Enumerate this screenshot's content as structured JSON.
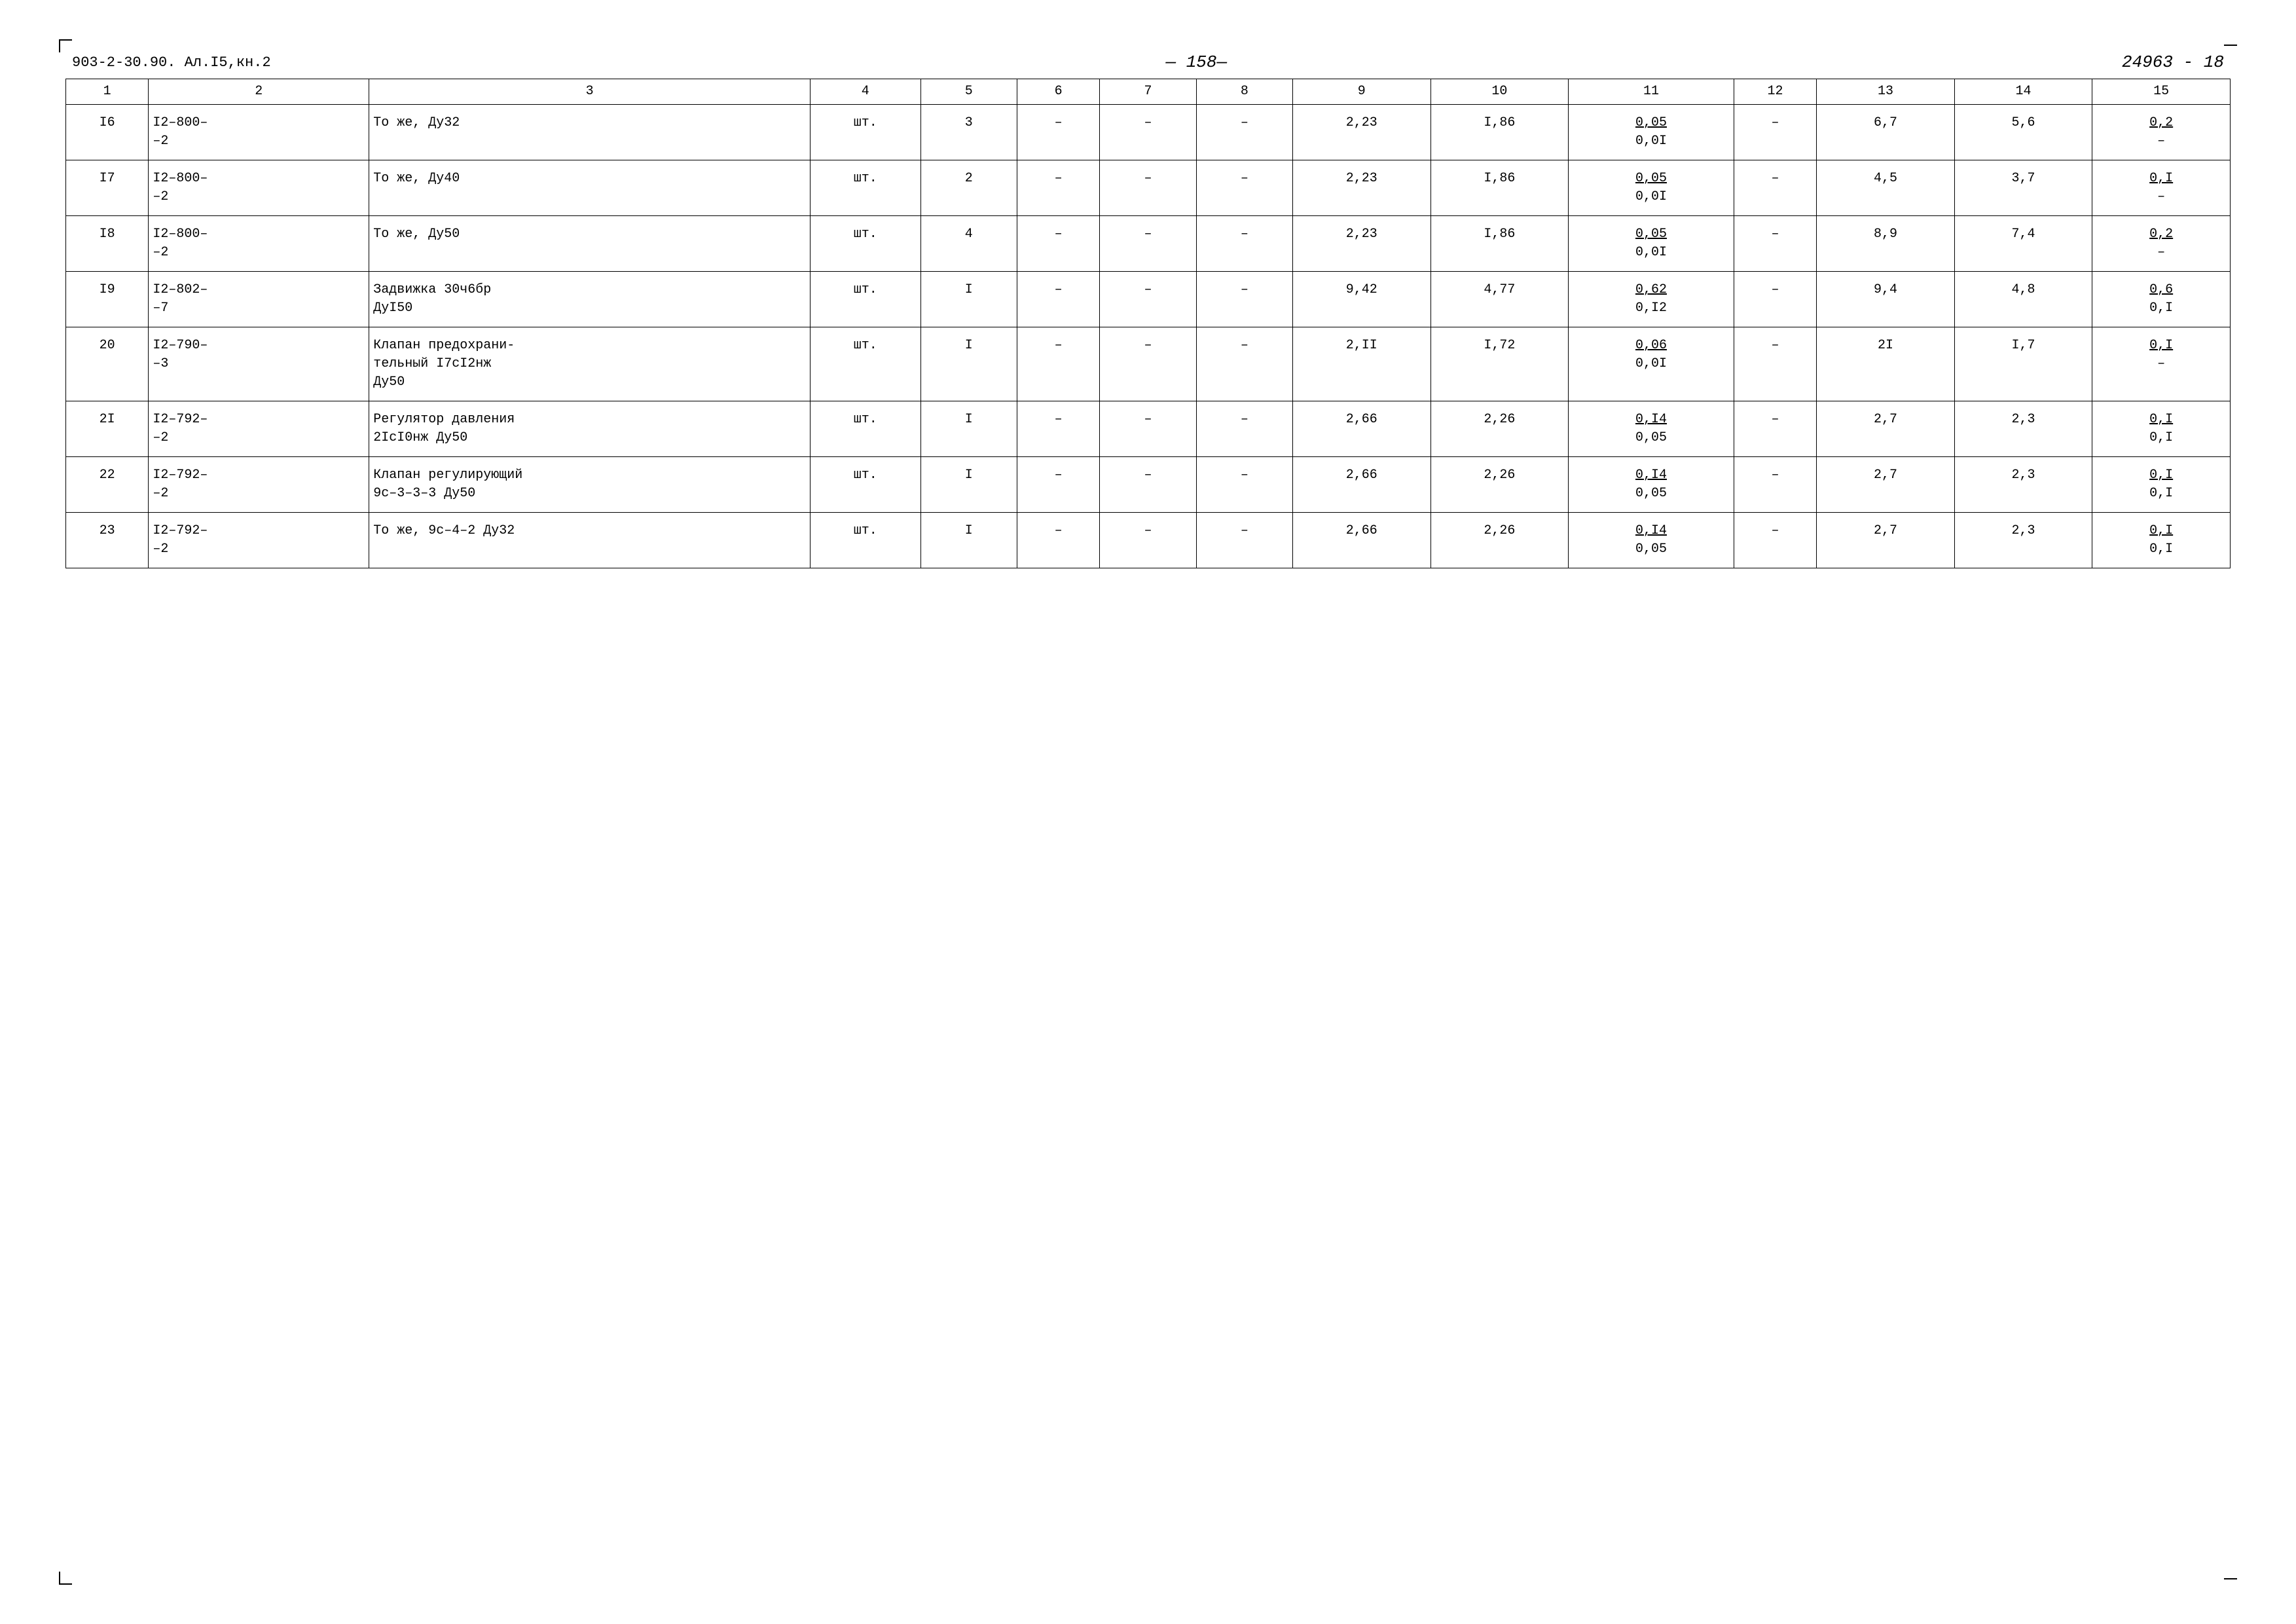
{
  "page": {
    "doc_number": "903-2-30.90. Ал.I5,кн.2",
    "page_number": "— 158—",
    "right_number": "24963 - 18",
    "top_corner": "Г",
    "bottom_corner": "└"
  },
  "table": {
    "headers": [
      "1",
      "2",
      "3",
      "4",
      "5",
      "6",
      "7",
      "8",
      "9",
      "10",
      "11",
      "12",
      "13",
      "14",
      "15"
    ],
    "rows": [
      {
        "col1": "I6",
        "col2": "I2–800–\n–2",
        "col3": "То же, Ду32",
        "col4": "шт.",
        "col5": "3",
        "col6": "–",
        "col7": "–",
        "col8": "–",
        "col9": "2,23",
        "col10": "I,86",
        "col11a": "0,05",
        "col11b": "0,0I",
        "col12": "–",
        "col13": "6,7",
        "col14": "5,6",
        "col15a": "0,2",
        "col15b": "–"
      },
      {
        "col1": "I7",
        "col2": "I2–800–\n–2",
        "col3": "То же, Ду40",
        "col4": "шт.",
        "col5": "2",
        "col6": "–",
        "col7": "–",
        "col8": "–",
        "col9": "2,23",
        "col10": "I,86",
        "col11a": "0,05",
        "col11b": "0,0I",
        "col12": "–",
        "col13": "4,5",
        "col14": "3,7",
        "col15a": "0,I",
        "col15b": "–"
      },
      {
        "col1": "I8",
        "col2": "I2–800–\n–2",
        "col3": "То же, Ду50",
        "col4": "шт.",
        "col5": "4",
        "col6": "–",
        "col7": "–",
        "col8": "–",
        "col9": "2,23",
        "col10": "I,86",
        "col11a": "0,05",
        "col11b": "0,0I",
        "col12": "–",
        "col13": "8,9",
        "col14": "7,4",
        "col15a": "0,2",
        "col15b": "–"
      },
      {
        "col1": "I9",
        "col2": "I2–802–\n–7",
        "col3": "Задвижка 30ч6бр\nДуI50",
        "col4": "шт.",
        "col5": "I",
        "col6": "–",
        "col7": "–",
        "col8": "–",
        "col9": "9,42",
        "col10": "4,77",
        "col11a": "0,62",
        "col11b": "0,I2",
        "col12": "–",
        "col13": "9,4",
        "col14": "4,8",
        "col15a": "0,6",
        "col15b": "0,I"
      },
      {
        "col1": "20",
        "col2": "I2–790–\n–3",
        "col3": "Клапан предохрани-\nтельный I7сI2нж\nДу50",
        "col4": "шт.",
        "col5": "I",
        "col6": "–",
        "col7": "–",
        "col8": "–",
        "col9": "2,II",
        "col10": "I,72",
        "col11a": "0,06",
        "col11b": "0,0I",
        "col12": "–",
        "col13": "2I",
        "col14": "I,7",
        "col15a": "0,I",
        "col15b": "–"
      },
      {
        "col1": "2I",
        "col2": "I2–792–\n–2",
        "col3": "Регулятор давления\n2IсI0нж Ду50",
        "col4": "шт.",
        "col5": "I",
        "col6": "–",
        "col7": "–",
        "col8": "–",
        "col9": "2,66",
        "col10": "2,26",
        "col11a": "0,I4",
        "col11b": "0,05",
        "col12": "–",
        "col13": "2,7",
        "col14": "2,3",
        "col15a": "0,I",
        "col15b": "0,I"
      },
      {
        "col1": "22",
        "col2": "I2–792–\n–2",
        "col3": "Клапан регулирующий\n9с–3–3–3 Ду50",
        "col4": "шт.",
        "col5": "I",
        "col6": "–",
        "col7": "–",
        "col8": "–",
        "col9": "2,66",
        "col10": "2,26",
        "col11a": "0,I4",
        "col11b": "0,05",
        "col12": "–",
        "col13": "2,7",
        "col14": "2,3",
        "col15a": "0,I",
        "col15b": "0,I"
      },
      {
        "col1": "23",
        "col2": "I2–792–\n–2",
        "col3": "То же, 9с–4–2 Ду32",
        "col4": "шт.",
        "col5": "I",
        "col6": "–",
        "col7": "–",
        "col8": "–",
        "col9": "2,66",
        "col10": "2,26",
        "col11a": "0,I4",
        "col11b": "0,05",
        "col12": "–",
        "col13": "2,7",
        "col14": "2,3",
        "col15a": "0,I",
        "col15b": "0,I"
      }
    ]
  }
}
